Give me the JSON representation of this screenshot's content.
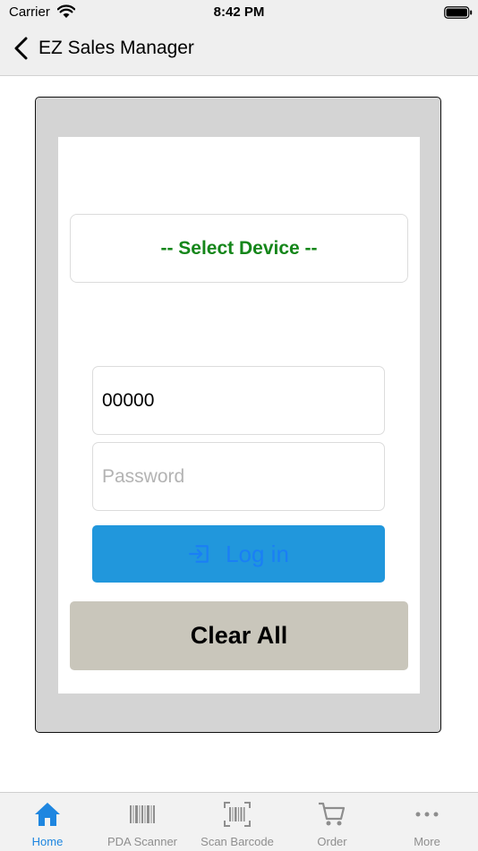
{
  "status_bar": {
    "carrier": "Carrier",
    "time": "8:42 PM"
  },
  "nav": {
    "title": "EZ Sales Manager"
  },
  "login_form": {
    "device_label": "-- Select Device --",
    "username_value": "00000",
    "password_placeholder": "Password",
    "login_label": "Log in",
    "clear_label": "Clear All"
  },
  "tabs": [
    {
      "label": "Home",
      "icon": "home-icon"
    },
    {
      "label": "PDA Scanner",
      "icon": "barcode-icon"
    },
    {
      "label": "Scan Barcode",
      "icon": "barcode-scan-icon"
    },
    {
      "label": "Order",
      "icon": "cart-icon"
    },
    {
      "label": "More",
      "icon": "more-icon"
    }
  ],
  "colors": {
    "accent": "#1e86e0",
    "device_text": "#15861a",
    "login_bg": "#2197dc",
    "clear_bg": "#c9c6bb",
    "frame_bg": "#d4d4d4"
  }
}
